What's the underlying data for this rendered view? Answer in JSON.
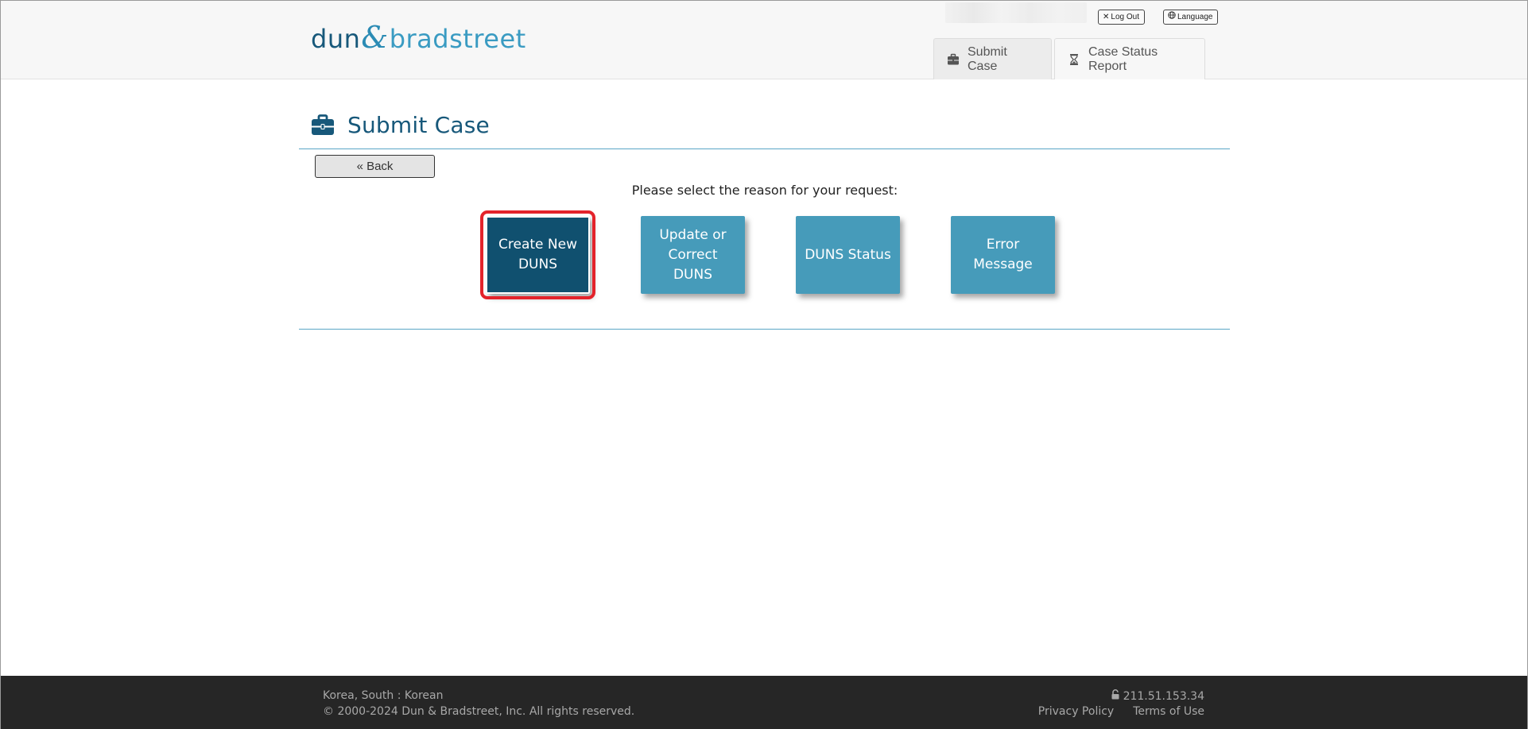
{
  "header": {
    "logo": {
      "part1": "dun",
      "amp": "&",
      "part2": "bradstreet"
    },
    "logout_label": "Log Out",
    "language_label": "Language",
    "tabs": [
      {
        "label": "Submit Case",
        "icon": "briefcase-icon",
        "active": true
      },
      {
        "label": "Case Status Report",
        "icon": "hourglass-icon",
        "active": false
      }
    ]
  },
  "main": {
    "title": "Submit Case",
    "back_label": "« Back",
    "prompt": "Please select the reason for your request:",
    "reasons": [
      {
        "label": "Create New DUNS",
        "selected": true
      },
      {
        "label": "Update or Correct DUNS",
        "selected": false
      },
      {
        "label": "DUNS Status",
        "selected": false
      },
      {
        "label": "Error Message",
        "selected": false
      }
    ]
  },
  "footer": {
    "locale": "Korea, South : Korean",
    "copyright": "© 2000-2024 Dun & Bradstreet, Inc. All rights reserved.",
    "ip": "211.51.153.34",
    "privacy_label": "Privacy Policy",
    "terms_label": "Terms of Use"
  },
  "colors": {
    "brand_dark": "#17587a",
    "brand_light": "#469bba",
    "selected_button": "#10506f",
    "highlight_outline": "#e3232b",
    "footer_bg": "#262626"
  }
}
